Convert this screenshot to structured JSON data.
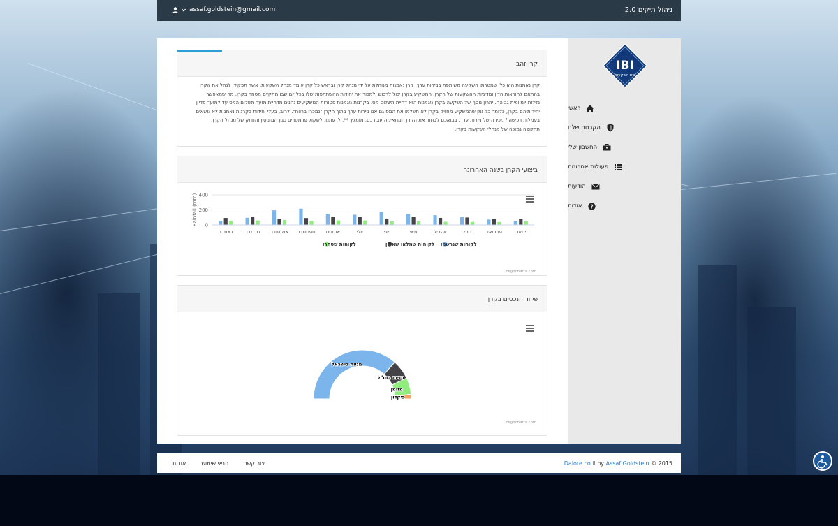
{
  "header": {
    "brand": "ניהול תיקים 2.0",
    "user_email": "assaf.goldstein@gmail.com"
  },
  "logo": {
    "text": "IBI",
    "subtitle": "בית השקעות"
  },
  "sidebar": {
    "items": [
      {
        "label": "ראשי",
        "icon": "home-icon"
      },
      {
        "label": "הקרנות שלנו",
        "icon": "shield-icon"
      },
      {
        "label": "החשבון שלי",
        "icon": "briefcase-icon"
      },
      {
        "label": "פעולות אחרונות",
        "icon": "list-icon"
      },
      {
        "label": "הודעות",
        "icon": "envelope-icon"
      },
      {
        "label": "אודות",
        "icon": "question-icon"
      }
    ]
  },
  "fund": {
    "title": "קרן זהב",
    "description": "קרן נאמנות היא כלי שמטרתו השקעה משותפת בניירות ערך. קרן נאמנות מנוהלת על ידי מנהל קרן ובראש כל קרן עומד מנהל השקעות, אשר תפקידו לנהל את הקרן בהתאם להוראות הדין ומדיניות ההשקעות של הקרן. המשקיע בקרן יכול לרכוש ולמכור את יחידות ההשתתפות שלו בכל יום שבו מתקיים מסחר בקרן, מה שמאפשר נזילות יומיומית גבוהה. יתרון נוסף של השקעה בקרן נאמנות הוא דחיית תשלום מס. בקרנות נאמנות פטורות המשקיעים נהנים מדחיית מועד תשלום המס עד למועד פדיון יחידותיהם בקרן, כלומר כל זמן שהמשקיע מחזיק בקרן לא תשלמו את המס גם אם ניירות ערך בתוך הקרן \"נמכרו ברווח\". לרוב, בעלי יחידות בקרנות נאמנות לא נושאים בעמלות רכישה / מכירה של ניירות ערך. בבואכם לבחור את הקרן המתאימה עבורכם, מומלץ **, לדעתנו, לשקול פרמטרים כגון המוניטין והוותק של מנהל הקרן, תחלופה נמוכה של מנהלי השקעות בקרן,"
  },
  "performance_panel": {
    "title": "ביצועי הקרן בשנה האחרונה",
    "credits": "Highcharts.com"
  },
  "assets_panel": {
    "title": "פיזור הנכסים בקרן",
    "credits": "Highcharts.com"
  },
  "chart_data": [
    {
      "type": "bar",
      "title": "",
      "xlabel": "",
      "ylabel": "Rainfall (mm)",
      "ylim": [
        0,
        400
      ],
      "yticks": [
        "0",
        "200",
        "400"
      ],
      "grid": true,
      "legend_position": "bottom",
      "categories": [
        "ינואר",
        "פברואר",
        "מרץ",
        "אפריל",
        "מאי",
        "יוני",
        "יולי",
        "אוגוסט",
        "ספטמבר",
        "אוקטובר",
        "נובמבר",
        "דצמבר"
      ],
      "series": [
        {
          "name": "לקוחות שנרשמו",
          "color": "#7cb5ec",
          "values": [
            49.9,
            71.5,
            106.4,
            129.2,
            144.0,
            176.0,
            135.6,
            148.5,
            216.4,
            194.1,
            95.6,
            54.4
          ]
        },
        {
          "name": "לקוחות שמלאו שאלון",
          "color": "#434348",
          "values": [
            83.6,
            78.8,
            98.5,
            93.4,
            106.0,
            84.5,
            105.0,
            104.3,
            91.2,
            83.5,
            106.6,
            92.3
          ]
        },
        {
          "name": "לקוחות שסחרו",
          "color": "#90ed7d",
          "values": [
            48.9,
            38.8,
            39.3,
            41.4,
            47.0,
            48.3,
            59.0,
            59.6,
            52.4,
            65.2,
            59.3,
            51.2
          ]
        }
      ]
    },
    {
      "type": "pie",
      "variant": "semi-donut",
      "title": "",
      "slices": [
        {
          "label": "מניות בישראל",
          "value": 73.0,
          "color": "#7cb5ec"
        },
        {
          "label": "מניות בחו\"ל",
          "value": 13.0,
          "color": "#434348"
        },
        {
          "label": "מזומן",
          "value": 11.0,
          "color": "#90ed7d"
        },
        {
          "label": "פיקדון",
          "value": 3.0,
          "color": "#f7a35c"
        }
      ]
    }
  ],
  "footer": {
    "links": [
      "צור קשר",
      "תנאי שימוש",
      "אודות"
    ],
    "copyright_prefix": "© 2015",
    "author": "Assaf Goldstein",
    "by": "by",
    "site": "Dalore.co.il"
  }
}
